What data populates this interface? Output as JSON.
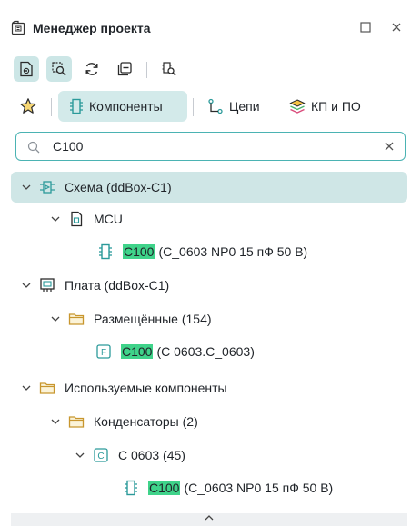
{
  "window": {
    "title": "Менеджер проекта"
  },
  "toolbar": {
    "buttons": [
      "view-toggle",
      "filter-focus",
      "refresh",
      "collapse-all",
      "locate"
    ]
  },
  "tabs": [
    {
      "label": "Компоненты",
      "active": true
    },
    {
      "label": "Цепи",
      "active": false
    },
    {
      "label": "КП и ПО",
      "active": false
    }
  ],
  "search": {
    "value": "C100",
    "placeholder": ""
  },
  "tree": [
    {
      "text": "Схема (ddBox-C1)",
      "icon": "schematic-icon",
      "expanded": true,
      "selected": true,
      "level": 0
    },
    {
      "text": "MCU",
      "icon": "sheet-icon",
      "expanded": true,
      "level": 1
    },
    {
      "match": "C100",
      "text": "(C_0603 NP0 15 пФ 50 В)",
      "icon": "component-icon",
      "level": 3
    },
    {
      "text": "Плата (ddBox-C1)",
      "icon": "board-icon",
      "expanded": true,
      "level": 0
    },
    {
      "text": "Размещённые (154)",
      "icon": "folder-icon",
      "expanded": true,
      "level": 1
    },
    {
      "match": "C100",
      "text": "(C 0603.C_0603)",
      "icon": "footprint-icon",
      "badge": "F",
      "level": 3
    },
    {
      "text": "Используемые компоненты",
      "icon": "folder-icon",
      "expanded": true,
      "level": 0
    },
    {
      "text": "Конденсаторы (2)",
      "icon": "folder-icon",
      "expanded": true,
      "level": 1
    },
    {
      "text": "C 0603 (45)",
      "icon": "component-type-icon",
      "badge": "C",
      "expanded": true,
      "level": 2
    },
    {
      "match": "C100",
      "text": "(C_0603 NP0 15 пФ 50 В)",
      "icon": "component-icon",
      "level": 4
    }
  ],
  "colors": {
    "accent": "#4bb3b3",
    "selected": "#cfe6e6",
    "highlight": "#3fd38a"
  }
}
